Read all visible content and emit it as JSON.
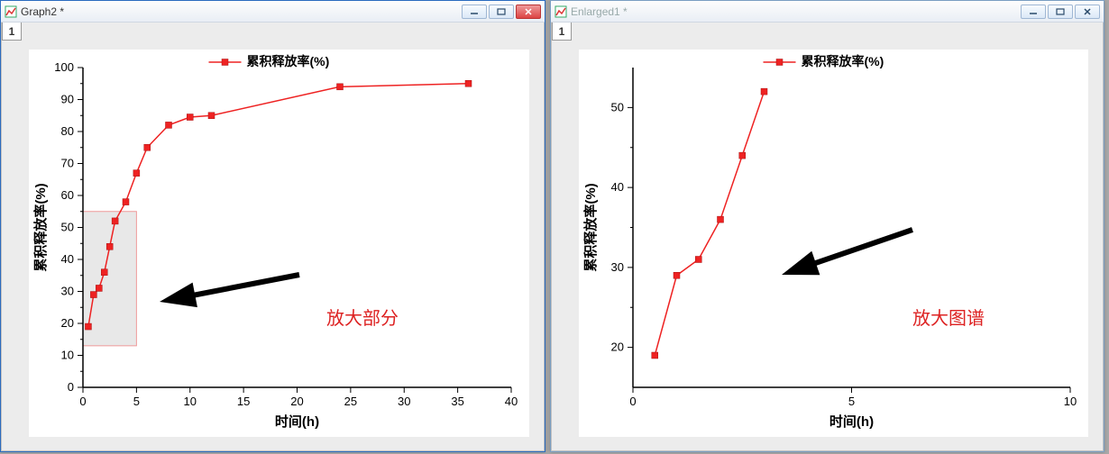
{
  "windows": [
    {
      "id": "w1",
      "title": "Graph2 *",
      "active": true,
      "tab": "1",
      "annotation": "放大部分"
    },
    {
      "id": "w2",
      "title": "Enlarged1 *",
      "active": false,
      "tab": "1",
      "annotation": "放大图谱"
    }
  ],
  "legend_label": "累积释放率(%)",
  "chart_data": [
    {
      "id": "w1",
      "type": "line",
      "title": "",
      "xlabel": "时间(h)",
      "ylabel": "累积释放率(%)",
      "xlim": [
        0,
        40
      ],
      "ylim": [
        0,
        100
      ],
      "xticks": [
        0,
        5,
        10,
        15,
        20,
        25,
        30,
        35,
        40
      ],
      "yticks": [
        0,
        10,
        20,
        30,
        40,
        50,
        60,
        70,
        80,
        90,
        100
      ],
      "series": [
        {
          "name": "累积释放率(%)",
          "x": [
            0.5,
            1,
            1.5,
            2,
            2.5,
            3,
            4,
            5,
            6,
            8,
            10,
            12,
            24,
            36
          ],
          "y": [
            19,
            29,
            31,
            36,
            44,
            52,
            58,
            67,
            75,
            82,
            84.5,
            85,
            94,
            95
          ]
        }
      ],
      "roi": {
        "x0": 0,
        "x1": 5,
        "y0": 13,
        "y1": 55
      }
    },
    {
      "id": "w2",
      "type": "line",
      "title": "",
      "xlabel": "时间(h)",
      "ylabel": "累积释放率(%)",
      "xlim": [
        0,
        10
      ],
      "ylim": [
        15,
        55
      ],
      "xticks": [
        0,
        5,
        10
      ],
      "yticks": [
        20,
        30,
        40,
        50
      ],
      "series": [
        {
          "name": "累积释放率(%)",
          "x": [
            0.5,
            1,
            1.5,
            2,
            2.5,
            3
          ],
          "y": [
            19,
            29,
            31,
            36,
            44,
            52
          ]
        }
      ]
    }
  ]
}
